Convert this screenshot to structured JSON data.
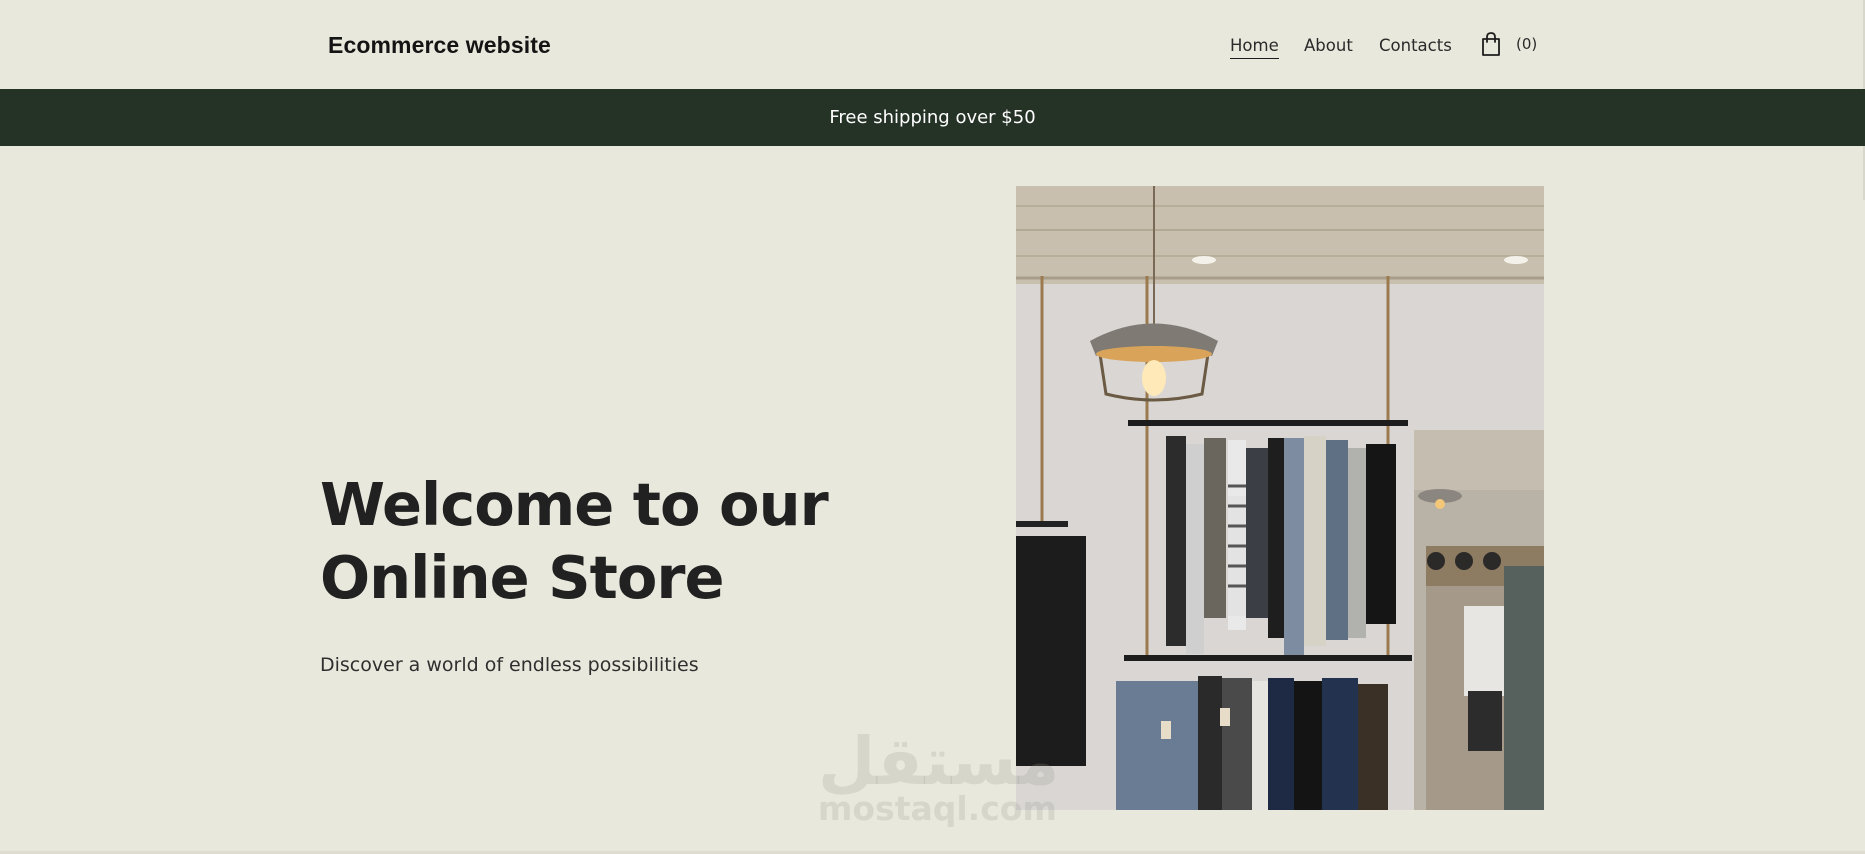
{
  "header": {
    "logo": "Ecommerce website",
    "nav": [
      {
        "label": "Home",
        "active": true
      },
      {
        "label": "About",
        "active": false
      },
      {
        "label": "Contacts",
        "active": false
      }
    ],
    "cart": {
      "icon": "shopping-bag-icon",
      "count_label": "(0)"
    }
  },
  "banner": {
    "text": "Free shipping over $50"
  },
  "hero": {
    "title_line1": "Welcome to our",
    "title_line2": "Online Store",
    "subtitle": "Discover a world of endless possibilities",
    "image_alt": "clothing rack store interior"
  },
  "watermark": {
    "arabic": "مستقل",
    "latin": "mostaql.com"
  },
  "colors": {
    "background": "#e9e8dc",
    "banner": "#253327",
    "banner_text": "#ffffff",
    "heading": "#212121"
  }
}
